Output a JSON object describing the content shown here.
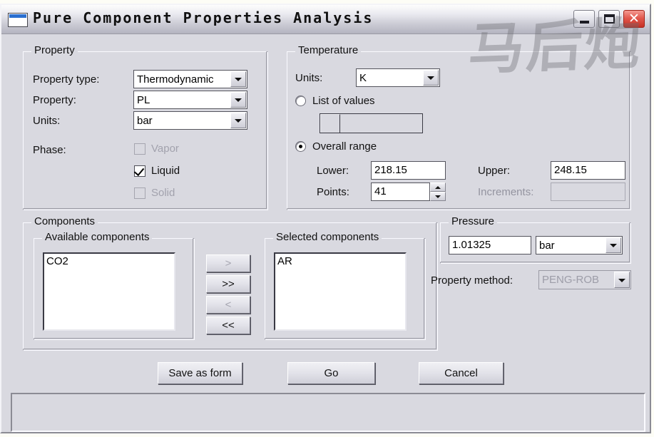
{
  "window": {
    "title": "Pure Component Properties Analysis",
    "icon": "window-icon",
    "watermark": "马后炮",
    "buttons": {
      "minimize": "minimize-icon",
      "maximize": "maximize-icon",
      "close": "✕"
    }
  },
  "property_group": {
    "legend": "Property",
    "property_type_label": "Property type:",
    "property_type_value": "Thermodynamic",
    "property_label": "Property:",
    "property_value": "PL",
    "units_label": "Units:",
    "units_value": "bar",
    "phase_label": "Phase:",
    "phases": [
      {
        "label": "Vapor",
        "checked": false,
        "enabled": false
      },
      {
        "label": "Liquid",
        "checked": true,
        "enabled": true
      },
      {
        "label": "Solid",
        "checked": false,
        "enabled": false
      }
    ]
  },
  "temperature_group": {
    "legend": "Temperature",
    "units_label": "Units:",
    "units_value": "K",
    "list_of_values_label": "List of values",
    "list_of_values_selected": false,
    "list_of_values_entry": "",
    "overall_range_label": "Overall range",
    "overall_range_selected": true,
    "lower_label": "Lower:",
    "lower_value": "218.15",
    "upper_label": "Upper:",
    "upper_value": "248.15",
    "points_label": "Points:",
    "points_value": "41",
    "increments_label": "Increments:",
    "increments_value": ""
  },
  "components_group": {
    "legend": "Components",
    "available_legend": "Available components",
    "available_items": [
      "CO2"
    ],
    "selected_legend": "Selected components",
    "selected_items": [
      "AR"
    ],
    "transfer_buttons": [
      {
        "label": ">",
        "enabled": false
      },
      {
        "label": ">>",
        "enabled": true
      },
      {
        "label": "<",
        "enabled": false
      },
      {
        "label": "<<",
        "enabled": true
      }
    ]
  },
  "pressure_group": {
    "legend": "Pressure",
    "value": "1.01325",
    "units_value": "bar",
    "property_method_label": "Property method:",
    "property_method_value": "PENG-ROB"
  },
  "actions": {
    "save_as_form": "Save as form",
    "go": "Go",
    "cancel": "Cancel"
  },
  "status_pane": {
    "text": ""
  },
  "colors": {
    "face": "#d9d9e0",
    "close_button": "#c62f23",
    "disabled_text": "#9d9da8",
    "title_accent": "#2a6fd0"
  }
}
